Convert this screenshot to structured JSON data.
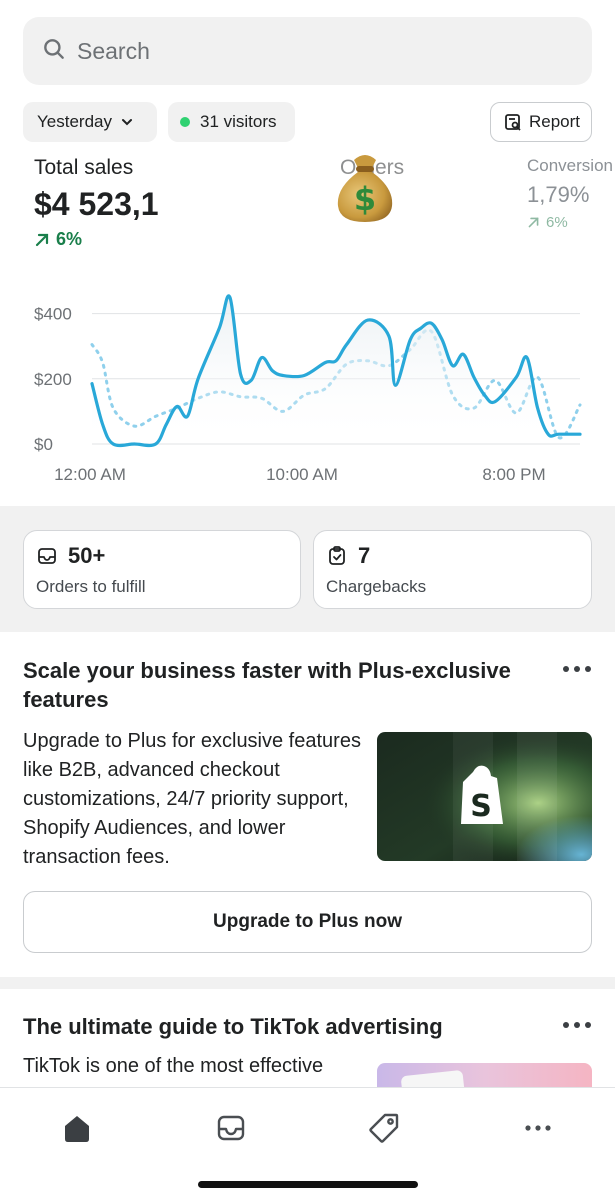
{
  "search": {
    "placeholder": "Search"
  },
  "filters": {
    "date": "Yesterday",
    "visitors": "31 visitors",
    "report": "Report"
  },
  "metrics": {
    "total_sales": {
      "label": "Total sales",
      "value": "$4 523,1",
      "change": "6%"
    },
    "orders": {
      "label": "Orders",
      "change": "6%"
    },
    "conversion": {
      "label": "Conversion",
      "value": "1,79%",
      "change": "6%"
    }
  },
  "chart_data": {
    "type": "line",
    "ytick_labels": [
      "$400",
      "$200",
      "$0"
    ],
    "xtick_labels": [
      "12:00 AM",
      "10:00 AM",
      "8:00 PM"
    ],
    "ylim": [
      0,
      460
    ],
    "xlim": [
      0,
      23
    ],
    "grid": true,
    "series": [
      {
        "style": "solid",
        "color": "#29a8d8",
        "x": [
          0,
          0.5,
          1,
          2,
          3,
          3.5,
          4,
          4.5,
          5,
          6,
          6.5,
          7,
          7.5,
          8,
          8.5,
          9,
          10,
          11,
          11.5,
          12,
          13,
          14,
          14.3,
          15,
          15.5,
          16,
          16.5,
          17,
          17.5,
          18,
          18.5,
          19,
          20,
          20.5,
          21,
          21.5,
          22,
          23
        ],
        "values": [
          185,
          60,
          0,
          0,
          0,
          60,
          115,
          85,
          200,
          355,
          450,
          215,
          195,
          265,
          225,
          210,
          210,
          250,
          255,
          305,
          380,
          330,
          180,
          320,
          355,
          370,
          320,
          240,
          275,
          205,
          150,
          130,
          205,
          265,
          110,
          30,
          30,
          30
        ]
      },
      {
        "style": "dotted",
        "color": "#8fd0ec",
        "x": [
          0,
          0.5,
          1,
          2,
          3,
          4,
          5,
          6,
          7,
          8,
          9,
          10,
          11,
          12,
          13,
          14,
          15,
          16,
          17,
          18,
          19,
          20,
          21,
          22,
          23
        ],
        "values": [
          305,
          250,
          110,
          55,
          85,
          110,
          140,
          160,
          145,
          140,
          100,
          150,
          170,
          245,
          255,
          240,
          290,
          345,
          150,
          110,
          195,
          95,
          205,
          20,
          120
        ]
      }
    ]
  },
  "tiles": [
    {
      "number": "50+",
      "label": "Orders to fulfill",
      "icon": "inbox-icon"
    },
    {
      "number": "7",
      "label": "Chargebacks",
      "icon": "clipboard-check-icon"
    }
  ],
  "promo": {
    "title_line1": "Scale your business faster with Plus-exclusive",
    "title_line2": "features",
    "body": [
      "Upgrade to Plus for exclusive features",
      "like B2B, advanced checkout",
      "customizations, 24/7 priority support,",
      "Shopify Audiences, and lower",
      "transaction fees."
    ],
    "cta": "Upgrade to Plus now"
  },
  "guide": {
    "title": "The ultimate guide to TikTok advertising",
    "body": "TikTok is one of the most effective"
  },
  "tabbar": {
    "items": [
      "home-icon",
      "orders-icon",
      "products-icon",
      "more-icon"
    ]
  },
  "colors": {
    "accent": "#29a8d8",
    "positive": "#1a7f4b",
    "live": "#2fd171"
  }
}
